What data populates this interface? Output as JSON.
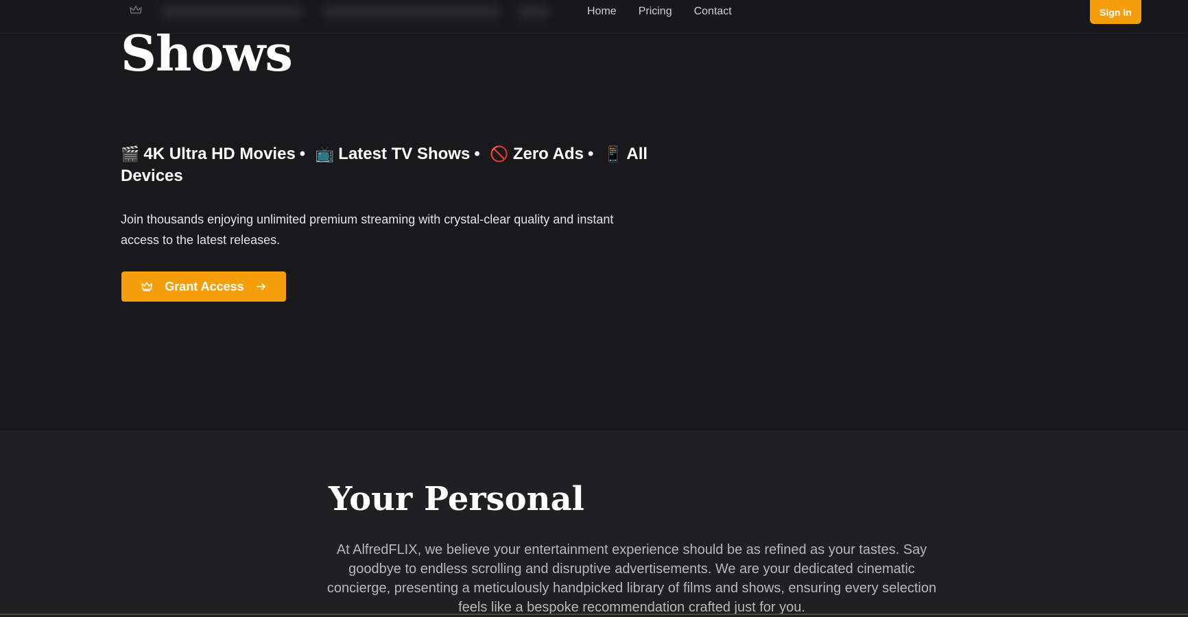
{
  "nav": {
    "links": [
      "Home",
      "Pricing",
      "Contact"
    ],
    "signin_label": "Sign In",
    "logo_icon": "crown-icon"
  },
  "hero": {
    "title": "Shows",
    "features": [
      {
        "emoji": "🎬",
        "label": "4K Ultra HD Movies"
      },
      {
        "emoji": "📺",
        "label": "Latest TV Shows"
      },
      {
        "emoji": "🚫",
        "label": "Zero Ads"
      },
      {
        "emoji": "📱",
        "label": "All Devices"
      }
    ],
    "separator": "•",
    "description": "Join thousands enjoying unlimited premium streaming with crystal-clear quality and instant access to the latest releases.",
    "cta_label": "Grant Access"
  },
  "about": {
    "title": "Your Personal",
    "text": "At AlfredFLIX, we believe your entertainment experience should be as refined as your tastes. Say goodbye to endless scrolling and disruptive advertisements. We are your dedicated cinematic concierge, presenting a meticulously handpicked library of films and shows, ensuring every selection feels like a bespoke recommendation crafted just for you."
  },
  "colors": {
    "accent": "#f59e0b",
    "background": "#19191c",
    "section_bg": "#202023"
  }
}
